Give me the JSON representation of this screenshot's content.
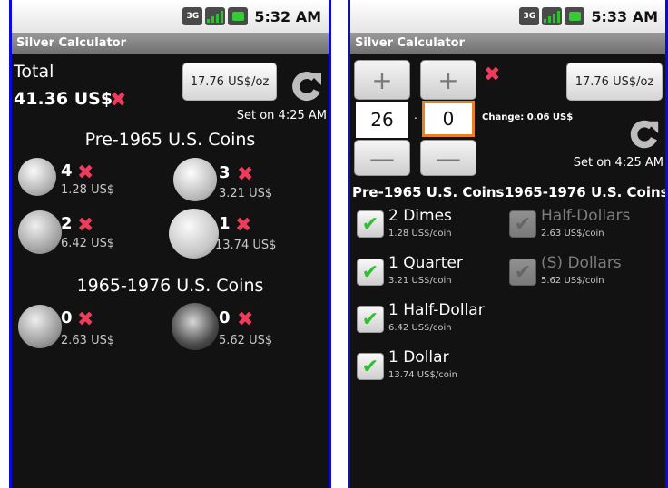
{
  "left": {
    "status_time": "5:32 AM",
    "app_title": "Silver Calculator",
    "total_label": "Total",
    "total_value": "41.36 US$",
    "price_button": "17.76 US$/oz",
    "set_on": "Set on 4:25 AM",
    "pre_heading": "Pre-1965 U.S. Coins",
    "post_heading": "1965-1976 U.S. Coins",
    "coins": [
      {
        "count": "4",
        "value": "1.28 US$",
        "icon": "dime-coin-icon"
      },
      {
        "count": "3",
        "value": "3.21 US$",
        "icon": "quarter-coin-icon"
      },
      {
        "count": "2",
        "value": "6.42 US$",
        "icon": "half-dollar-coin-icon"
      },
      {
        "count": "1",
        "value": "13.74 US$",
        "icon": "dollar-coin-icon"
      },
      {
        "count": "0",
        "value": "2.63 US$",
        "icon": "kennedy-half-coin-icon"
      },
      {
        "count": "0",
        "value": "5.62 US$",
        "icon": "eisenhower-dollar-coin-icon"
      }
    ]
  },
  "right": {
    "status_time": "5:33 AM",
    "app_title": "Silver Calculator",
    "plus": "+",
    "minus": "—",
    "digit_whole": "26",
    "separator": ".",
    "digit_fraction": "0",
    "change": "Change: 0.06 US$",
    "price_button": "17.76 US$/oz",
    "set_on": "Set on 4:25 AM",
    "pre_heading": "Pre-1965 U.S. Coins",
    "post_heading": "1965-1976 U.S. Coins",
    "pre_items": [
      {
        "name": "2 Dimes",
        "price": "1.28 US$/coin",
        "checked": true
      },
      {
        "name": "1 Quarter",
        "price": "3.21 US$/coin",
        "checked": true
      },
      {
        "name": "1 Half-Dollar",
        "price": "6.42 US$/coin",
        "checked": true
      },
      {
        "name": "1 Dollar",
        "price": "13.74 US$/coin",
        "checked": true
      }
    ],
    "post_items": [
      {
        "name": "Half-Dollars",
        "price": "2.63 US$/coin",
        "checked": false
      },
      {
        "name": "(S) Dollars",
        "price": "5.62 US$/coin",
        "checked": false
      }
    ]
  },
  "status_icons": {
    "network": "3G"
  },
  "colors": {
    "accent_x": "#f03c5c",
    "check_green": "#2fbf2f",
    "focus_orange": "#e8821e",
    "frame_blue": "#0a0adb"
  }
}
